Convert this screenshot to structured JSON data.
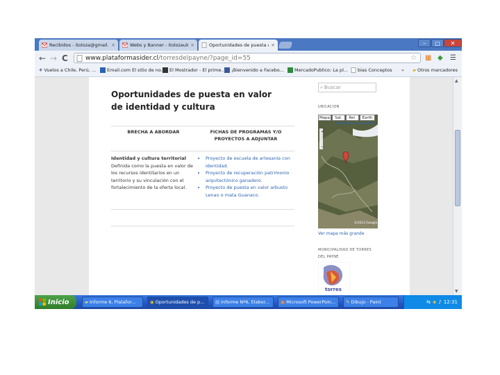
{
  "tabs": [
    {
      "label": "Recibidos - itoloza@gmail.co",
      "close": "×"
    },
    {
      "label": "Webs y Banner - itolozaulro",
      "close": "×"
    },
    {
      "label": "Oportunidades de puesta en",
      "close": "×"
    }
  ],
  "window": {
    "minimize": "–",
    "maximize": "□",
    "close": "✕"
  },
  "toolbar": {
    "back": "←",
    "forward": "→",
    "reload": "C",
    "url_domain": "www.plataformasider.cl",
    "url_path": "/torresdelpayne/?page_id=55"
  },
  "bookmarks": [
    {
      "label": "Vuelos a Chile, Perú, ..."
    },
    {
      "label": "Email.com El sitio de no..."
    },
    {
      "label": "El Mostrador - El prime..."
    },
    {
      "label": "¡Bienvenido a Facebo..."
    },
    {
      "label": "MercadoPublico: La pl..."
    },
    {
      "label": "bias Conceptos"
    }
  ],
  "bookmarks_more": "»",
  "bookmarks_other": "Otros marcadores",
  "page": {
    "title": "Oportunidades de puesta en valor de identidad y cultura",
    "col1_header": "BRECHA A ABORDAR",
    "col2_header": "FICHAS DE PROGRAMAS Y/O PROYECTOS A ADJUNTAR",
    "row1_heading": "Identidad y cultura territorial",
    "row1_text": "Definida como la puesta en valor de los recursos identitarios en un territorio y su vinculación con el fortalecimiento de la oferta local.",
    "row1_links": [
      "Proyecto de escuela de artesanía con identidad.",
      "Proyecto de recuperación patrimonio arquitectónico ganadero.",
      "Proyecto de puesta en valor arbusto Lenao o mata Guanaco."
    ]
  },
  "sidebar": {
    "search_placeholder": "Buscar",
    "location_heading": "UBICACION",
    "map_buttons": [
      "Mapa",
      "Sat.",
      "Rel.",
      "Earth"
    ],
    "map_alt_link": "Buscar en alrededor",
    "map_copyright": "©2013 Google",
    "map_link": "Ver mapa más grande",
    "municipality_heading": "MUNICIPALIDAD DE TORRES DEL PAYNE",
    "logo_text": "torres"
  },
  "taskbar": {
    "start_label": "Inicio",
    "tasks": [
      {
        "label": "Informe 6, Platafor..."
      },
      {
        "label": "Oportunidades de p..."
      },
      {
        "label": "Informe Nº6, Elabor..."
      },
      {
        "label": "Microsoft PowerPoin..."
      },
      {
        "label": "Dibujo - Paint"
      }
    ],
    "clock": "12:31"
  },
  "colors": {
    "titlebar": "#4a78c2",
    "link": "#2a63b3",
    "taskbar": "#2457c4",
    "start": "#2f7d2a",
    "tray": "#0f8ae6"
  }
}
